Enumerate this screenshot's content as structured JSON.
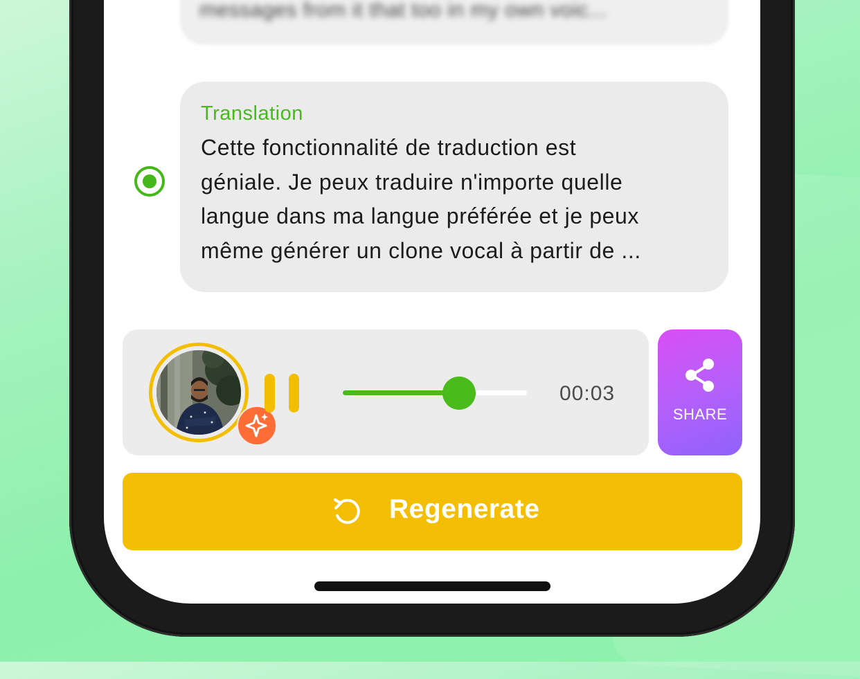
{
  "previous_message": {
    "text": "messages from it that too in my own voic..."
  },
  "translation": {
    "label": "Translation",
    "text_lines": [
      "Cette fonctionnalité de traduction est",
      "géniale. Je peux traduire n'importe quelle",
      "langue dans ma langue préférée et je peux",
      "même générer un clone vocal à partir de ..."
    ],
    "selected": true
  },
  "player": {
    "time": "00:03",
    "progress_fraction": 0.63,
    "state": "playing",
    "avatar_badge_icon": "sparkle-icon"
  },
  "share": {
    "label": "SHARE",
    "icon": "share-icon"
  },
  "regenerate": {
    "label": "Regenerate",
    "icon": "refresh-icon"
  },
  "colors": {
    "accent_green": "#47b91d",
    "accent_yellow": "#f3be03",
    "share_gradient_start": "#d84ef6",
    "share_gradient_end": "#8f62fb",
    "badge_orange": "#ff6d36"
  }
}
